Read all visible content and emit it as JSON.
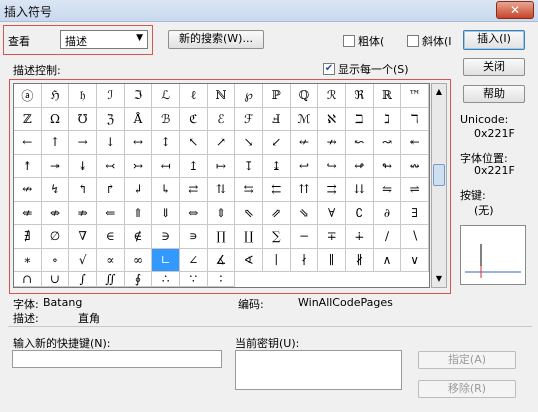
{
  "window": {
    "title": "插入符号",
    "close": "✕"
  },
  "top": {
    "view_label": "查看",
    "view_select": "描述",
    "new_search_button": "新的搜索(W)...",
    "bold_label": "粗体(",
    "italic_label": "斜体(I",
    "insert_button": "插入(I)"
  },
  "filter": {
    "label": "描述控制:",
    "show_each_label": "显示每一个(S)",
    "show_each_checked": true,
    "close_button": "关闭",
    "help_button": "帮助"
  },
  "info": {
    "unicode_label": "Unicode:",
    "unicode_value": "0x221F",
    "font_pos_label": "字体位置:",
    "font_pos_value": "0x221F",
    "key_label": "按键:",
    "key_value": "(无)"
  },
  "grid": {
    "rows": [
      [
        "ⓐ",
        "ℌ",
        "𝔥",
        "ℐ",
        "ℑ",
        "ℒ",
        "ℓ",
        "ℕ",
        "℘",
        "ℙ",
        "ℚ",
        "ℛ",
        "ℜ",
        "ℝ",
        "™",
        "ℤ"
      ],
      [
        "Ω",
        "℧",
        "ℨ",
        "Å",
        "ℬ",
        "ℭ",
        "ℰ",
        "ℱ",
        "Ⅎ",
        "ℳ",
        "ℵ",
        "ℶ",
        "ℷ",
        "ℸ",
        "←",
        "↑"
      ],
      [
        "→",
        "↓",
        "↔",
        "↕",
        "↖",
        "↗",
        "↘",
        "↙",
        "↚",
        "↛",
        "↜",
        "↝",
        "↞",
        "↟",
        "↠",
        "↡"
      ],
      [
        "↢",
        "↣",
        "↤",
        "↥",
        "↦",
        "↧",
        "↨",
        "↩",
        "↪",
        "↫",
        "↬",
        "↭",
        "↮",
        "↯",
        "↰",
        "↱"
      ],
      [
        "↲",
        "↳",
        "⇄",
        "⇅",
        "⇆",
        "⇇",
        "⇈",
        "⇉",
        "⇊",
        "⇋",
        "⇌",
        "⇍",
        "⇎",
        "⇏",
        "⇐",
        "⇑"
      ],
      [
        "⇓",
        "⇔",
        "⇕",
        "⇖",
        "⇗",
        "⇘",
        "∀",
        "∁",
        "∂",
        "∃",
        "∄",
        "∅",
        "∇",
        "∈",
        "∉",
        "∋"
      ],
      [
        "∍",
        "∏",
        "∐",
        "∑",
        "−",
        "∓",
        "∔",
        "∕",
        "∖",
        "∗",
        "∘",
        "√",
        "∝",
        "∞",
        "∟",
        "∠"
      ],
      [
        "∡",
        "∢",
        "∣",
        "∤",
        "∥",
        "∦",
        "∧",
        "∨",
        "∩",
        "∪",
        "∫",
        "∬",
        "∮",
        "∴",
        "∵",
        "∶"
      ]
    ],
    "selected_symbol": "∟"
  },
  "status": {
    "font_label": "字体:",
    "font_value": "Batang",
    "encoding_label": "编码:",
    "encoding_value": "WinAllCodePages",
    "desc_label": "描述:",
    "desc_value": "直角"
  },
  "shortcut": {
    "new_key_label": "输入新的快捷键(N):",
    "new_key_value": "",
    "current_key_label": "当前密钥(U):",
    "assign_button": "指定(A)",
    "remove_button": "移除(R)"
  }
}
